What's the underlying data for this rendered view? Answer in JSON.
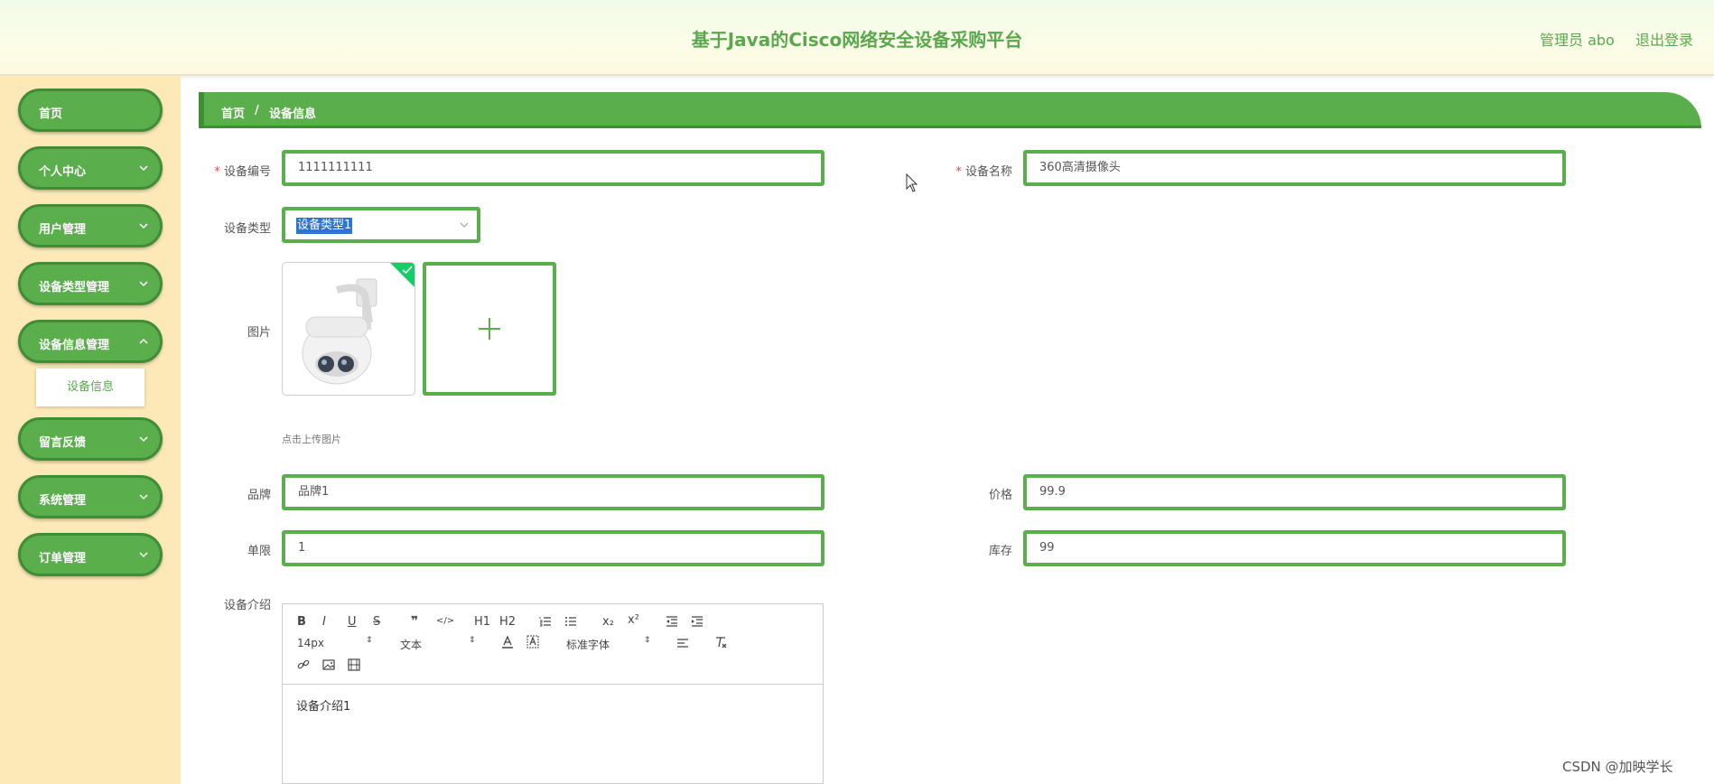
{
  "header": {
    "title": "基于Java的Cisco网络安全设备采购平台",
    "user": "管理员 abo",
    "logout": "退出登录"
  },
  "sidebar": {
    "items": [
      {
        "label": "首页",
        "has_chevron": false
      },
      {
        "label": "个人中心",
        "has_chevron": true
      },
      {
        "label": "用户管理",
        "has_chevron": true
      },
      {
        "label": "设备类型管理",
        "has_chevron": true
      },
      {
        "label": "设备信息管理",
        "has_chevron": true
      },
      {
        "label": "留言反馈",
        "has_chevron": true
      },
      {
        "label": "系统管理",
        "has_chevron": true
      },
      {
        "label": "订单管理",
        "has_chevron": true
      }
    ],
    "sub_item": "设备信息"
  },
  "breadcrumb": {
    "home": "首页",
    "separator": "/",
    "current": "设备信息"
  },
  "form": {
    "device_no": {
      "label": "设备编号",
      "value": "1111111111",
      "required": "*"
    },
    "device_name": {
      "label": "设备名称",
      "value": "360高清摄像头",
      "required": "*"
    },
    "device_type": {
      "label": "设备类型",
      "value": "设备类型1"
    },
    "image": {
      "label": "图片",
      "tip": "点击上传图片"
    },
    "brand": {
      "label": "品牌",
      "value": "品牌1"
    },
    "price": {
      "label": "价格",
      "value": "99.9"
    },
    "limit": {
      "label": "单限",
      "value": "1"
    },
    "stock": {
      "label": "库存",
      "value": "99"
    },
    "intro": {
      "label": "设备介绍",
      "content": "设备介绍1"
    }
  },
  "editor_toolbar": {
    "bold": "B",
    "italic": "I",
    "underline": "U",
    "strike": "S",
    "quote": "❞",
    "code": "</>",
    "h1": "H1",
    "h2": "H2",
    "sub": "x₂",
    "sup": "x²",
    "size": "14px",
    "header": "文本",
    "font": "标准字体"
  },
  "watermark": "CSDN @加映学长",
  "colors": {
    "accent": "#5aae4b",
    "accent_dark": "#3f8e35",
    "sidebar_bg": "#fde9b8",
    "title": "#5aa84d"
  }
}
